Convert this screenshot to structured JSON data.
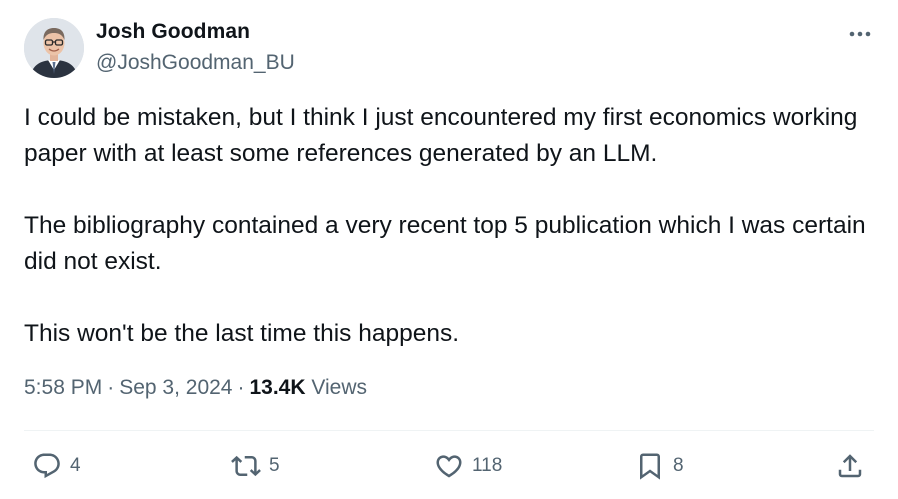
{
  "author": {
    "display_name": "Josh Goodman",
    "handle": "@JoshGoodman_BU",
    "avatar_icon": "person-photo-avatar"
  },
  "tweet": {
    "paragraphs": [
      "I could be mistaken, but I think I just encountered my first economics working paper with at least some references generated by an LLM.",
      "The bibliography contained a very recent top 5 publication which I was certain did not exist.",
      "This won't be the last time this happens."
    ],
    "time": "5:58 PM",
    "date": "Sep 3, 2024",
    "views_count": "13.4K",
    "views_label": "Views"
  },
  "actions": {
    "replies": "4",
    "reposts": "5",
    "likes": "118",
    "bookmarks": "8"
  },
  "colors": {
    "text": "#0f1419",
    "secondary": "#536471",
    "divider": "#eff3f4"
  }
}
